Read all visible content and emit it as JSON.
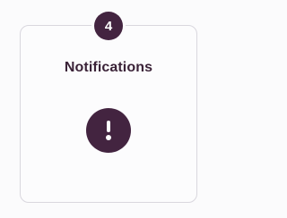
{
  "card": {
    "badge_count": "4",
    "title": "Notifications",
    "status_icon": "exclamation-circle-icon"
  },
  "colors": {
    "accent": "#432440",
    "title_text": "#3b2338",
    "card_border": "#d9d7de",
    "background": "#fbfbfc"
  }
}
